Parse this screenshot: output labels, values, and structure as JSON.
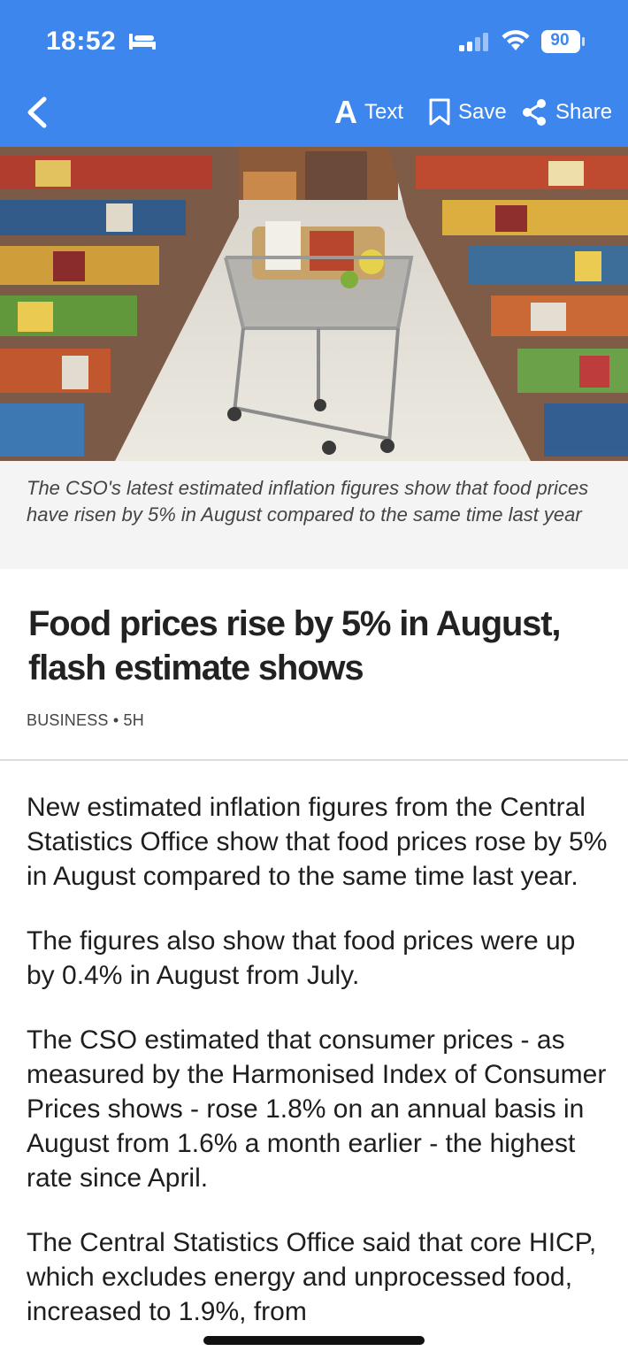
{
  "status_bar": {
    "time": "18:52",
    "battery": "90",
    "icons": [
      "bed-icon",
      "signal-icon",
      "wifi-icon",
      "battery-icon"
    ]
  },
  "toolbar": {
    "text_label": "Text",
    "save_label": "Save",
    "share_label": "Share",
    "icons": [
      "back-chevron-icon",
      "text-size-icon",
      "bookmark-icon",
      "share-icon"
    ]
  },
  "colors": {
    "header_bg": "#3d86ee",
    "caption_bg": "#f4f4f5"
  },
  "article": {
    "image_caption": "The CSO's latest estimated inflation figures show that food prices have risen by 5% in August compared to the same time last year",
    "headline": "Food prices rise by 5% in August, flash estimate shows",
    "category": "BUSINESS",
    "age": "5H",
    "paragraphs": [
      "New estimated inflation figures from the Central Statistics Office show that food prices rose by 5% in August compared to the same time last year.",
      "The figures also show that food prices were up by 0.4% in August from July.",
      "The CSO estimated that consumer prices - as measured by the Harmonised Index of Consumer Prices shows - rose 1.8% on an annual basis in August from 1.6% a month earlier - the highest rate since April.",
      "The Central Statistics Office said that core HICP, which excludes energy and unprocessed food, increased to 1.9%, from"
    ]
  }
}
